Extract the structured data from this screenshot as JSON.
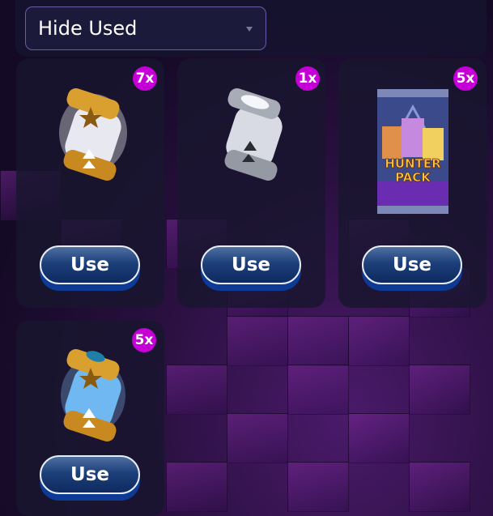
{
  "filter": {
    "selected": "Hide Used"
  },
  "items": [
    {
      "name": "Gold Capsule",
      "count": "7x",
      "button": "Use"
    },
    {
      "name": "Silver Capsule",
      "count": "1x",
      "button": "Use"
    },
    {
      "name": "Hunter Pack",
      "count": "5x",
      "button": "Use",
      "pack_text": [
        "HUNTER",
        "PACK"
      ]
    },
    {
      "name": "Blue Capsule",
      "count": "5x",
      "button": "Use"
    }
  ],
  "colors": {
    "badge": "#c400d6",
    "button": "#1d3f7a",
    "select_border": "#6a5aa8"
  }
}
